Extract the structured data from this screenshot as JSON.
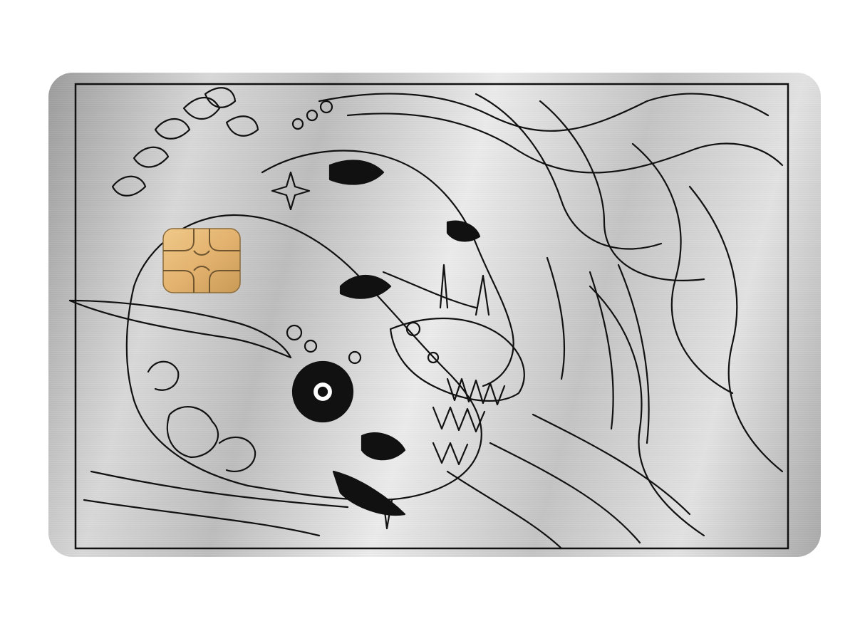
{
  "card": {
    "material": "brushed-metal",
    "colors": {
      "metal_light": "#ececec",
      "metal_dark": "#9c9c9c",
      "line_art": "#111111",
      "chip_gold_light": "#f0c98a",
      "chip_gold_dark": "#c99a55"
    },
    "elements": {
      "chip": "emv-chip-icon",
      "artwork": "engraved-illustration-skull-and-woman"
    }
  }
}
